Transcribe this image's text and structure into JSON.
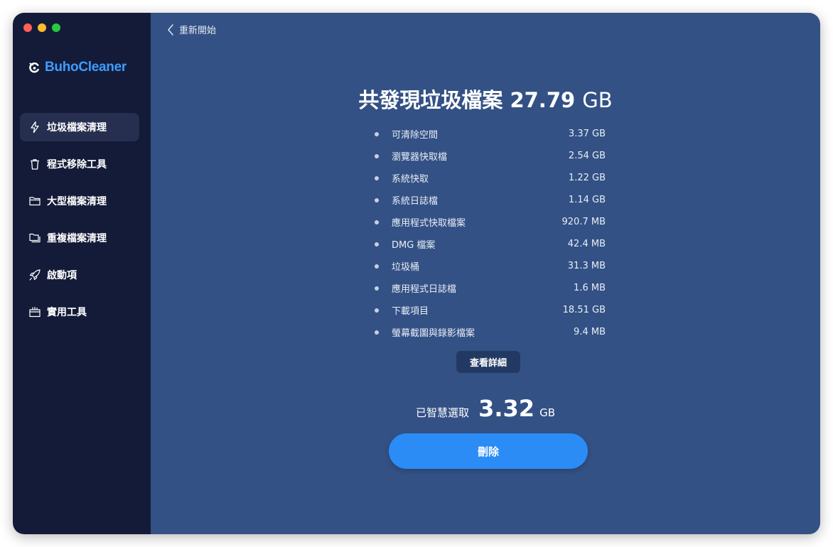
{
  "app": {
    "name": "BuhoCleaner",
    "brand_color": "#3d9cff",
    "sidebar_bg": "#141b38",
    "main_bg": "#335184"
  },
  "sidebar": {
    "items": [
      {
        "label": "垃圾檔案清理",
        "icon": "lightning-icon",
        "active": true
      },
      {
        "label": "程式移除工具",
        "icon": "trash-icon",
        "active": false
      },
      {
        "label": "大型檔案清理",
        "icon": "folder-icon",
        "active": false
      },
      {
        "label": "重複檔案清理",
        "icon": "duplicate-folder-icon",
        "active": false
      },
      {
        "label": "啟動項",
        "icon": "rocket-icon",
        "active": false
      },
      {
        "label": "實用工具",
        "icon": "toolbox-icon",
        "active": false
      }
    ]
  },
  "header": {
    "back_label": "重新開始"
  },
  "summary": {
    "title_prefix": "共發現垃圾檔案",
    "total_value": "27.79",
    "total_unit": "GB"
  },
  "items": [
    {
      "label": "可清除空間",
      "size": "3.37 GB"
    },
    {
      "label": "瀏覽器快取檔",
      "size": "2.54 GB"
    },
    {
      "label": "系統快取",
      "size": "1.22 GB"
    },
    {
      "label": "系統日誌檔",
      "size": "1.14 GB"
    },
    {
      "label": "應用程式快取檔案",
      "size": "920.7 MB"
    },
    {
      "label": "DMG 檔案",
      "size": "42.4 MB"
    },
    {
      "label": "垃圾桶",
      "size": "31.3 MB"
    },
    {
      "label": "應用程式日誌檔",
      "size": "1.6 MB"
    },
    {
      "label": "下載項目",
      "size": "18.51 GB"
    },
    {
      "label": "螢幕截圖與錄影檔案",
      "size": "9.4 MB"
    }
  ],
  "details_button": "查看詳細",
  "selection": {
    "label": "已智慧選取",
    "value": "3.32",
    "unit": "GB"
  },
  "delete_button": "刪除",
  "delete_color": "#2b8cf6"
}
